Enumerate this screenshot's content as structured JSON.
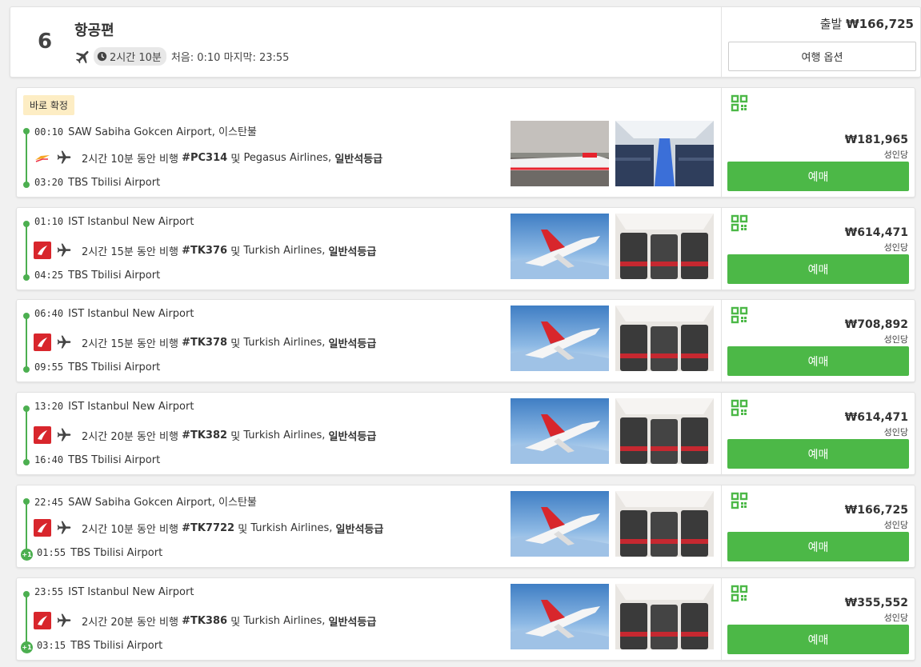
{
  "header": {
    "count": "6",
    "title": "항공편",
    "duration": "2시간 10분",
    "first_last": "처음: 0:10 마지막: 23:55",
    "price_label": "출발",
    "price": "₩166,725",
    "trip_options_label": "여행 옵션"
  },
  "flights": [
    {
      "badge": "바로 확정",
      "dep_time": "00:10",
      "dep_airport": "SAW Sabiha Gokcen Airport, 이스탄불",
      "duration_text": "2시간 10분 동안 비행",
      "flight_no": "#PC314",
      "joiner": "및",
      "airline": "Pegasus Airlines,",
      "cabin": "일반석등급",
      "arr_time": "03:20",
      "arr_airport": "TBS Tbilisi Airport",
      "next_day": "",
      "price": "₩181,965",
      "per_adult": "성인당",
      "book_label": "예매",
      "logo": "pegasus-logo"
    },
    {
      "badge": "",
      "dep_time": "01:10",
      "dep_airport": "IST Istanbul New Airport",
      "duration_text": "2시간 15분 동안 비행",
      "flight_no": "#TK376",
      "joiner": "및",
      "airline": "Turkish Airlines,",
      "cabin": "일반석등급",
      "arr_time": "04:25",
      "arr_airport": "TBS Tbilisi Airport",
      "next_day": "",
      "price": "₩614,471",
      "per_adult": "성인당",
      "book_label": "예매",
      "logo": "turkish-logo"
    },
    {
      "badge": "",
      "dep_time": "06:40",
      "dep_airport": "IST Istanbul New Airport",
      "duration_text": "2시간 15분 동안 비행",
      "flight_no": "#TK378",
      "joiner": "및",
      "airline": "Turkish Airlines,",
      "cabin": "일반석등급",
      "arr_time": "09:55",
      "arr_airport": "TBS Tbilisi Airport",
      "next_day": "",
      "price": "₩708,892",
      "per_adult": "성인당",
      "book_label": "예매",
      "logo": "turkish-logo"
    },
    {
      "badge": "",
      "dep_time": "13:20",
      "dep_airport": "IST Istanbul New Airport",
      "duration_text": "2시간 20분 동안 비행",
      "flight_no": "#TK382",
      "joiner": "및",
      "airline": "Turkish Airlines,",
      "cabin": "일반석등급",
      "arr_time": "16:40",
      "arr_airport": "TBS Tbilisi Airport",
      "next_day": "",
      "price": "₩614,471",
      "per_adult": "성인당",
      "book_label": "예매",
      "logo": "turkish-logo"
    },
    {
      "badge": "",
      "dep_time": "22:45",
      "dep_airport": "SAW Sabiha Gokcen Airport, 이스탄불",
      "duration_text": "2시간 10분 동안 비행",
      "flight_no": "#TK7722",
      "joiner": "및",
      "airline": "Turkish Airlines,",
      "cabin": "일반석등급",
      "arr_time": "01:55",
      "arr_airport": "TBS Tbilisi Airport",
      "next_day": "+1",
      "price": "₩166,725",
      "per_adult": "성인당",
      "book_label": "예매",
      "logo": "turkish-logo"
    },
    {
      "badge": "",
      "dep_time": "23:55",
      "dep_airport": "IST Istanbul New Airport",
      "duration_text": "2시간 20분 동안 비행",
      "flight_no": "#TK386",
      "joiner": "및",
      "airline": "Turkish Airlines,",
      "cabin": "일반석등급",
      "arr_time": "03:15",
      "arr_airport": "TBS Tbilisi Airport",
      "next_day": "+1",
      "price": "₩355,552",
      "per_adult": "성인당",
      "book_label": "예매",
      "logo": "turkish-logo"
    }
  ],
  "icons": {
    "plane": "plane-icon",
    "clock": "clock-icon",
    "qr": "qr-code-icon"
  },
  "colors": {
    "accent_green": "#4cb847",
    "badge_bg": "#fdedc4",
    "turkish_red": "#d8262c"
  }
}
